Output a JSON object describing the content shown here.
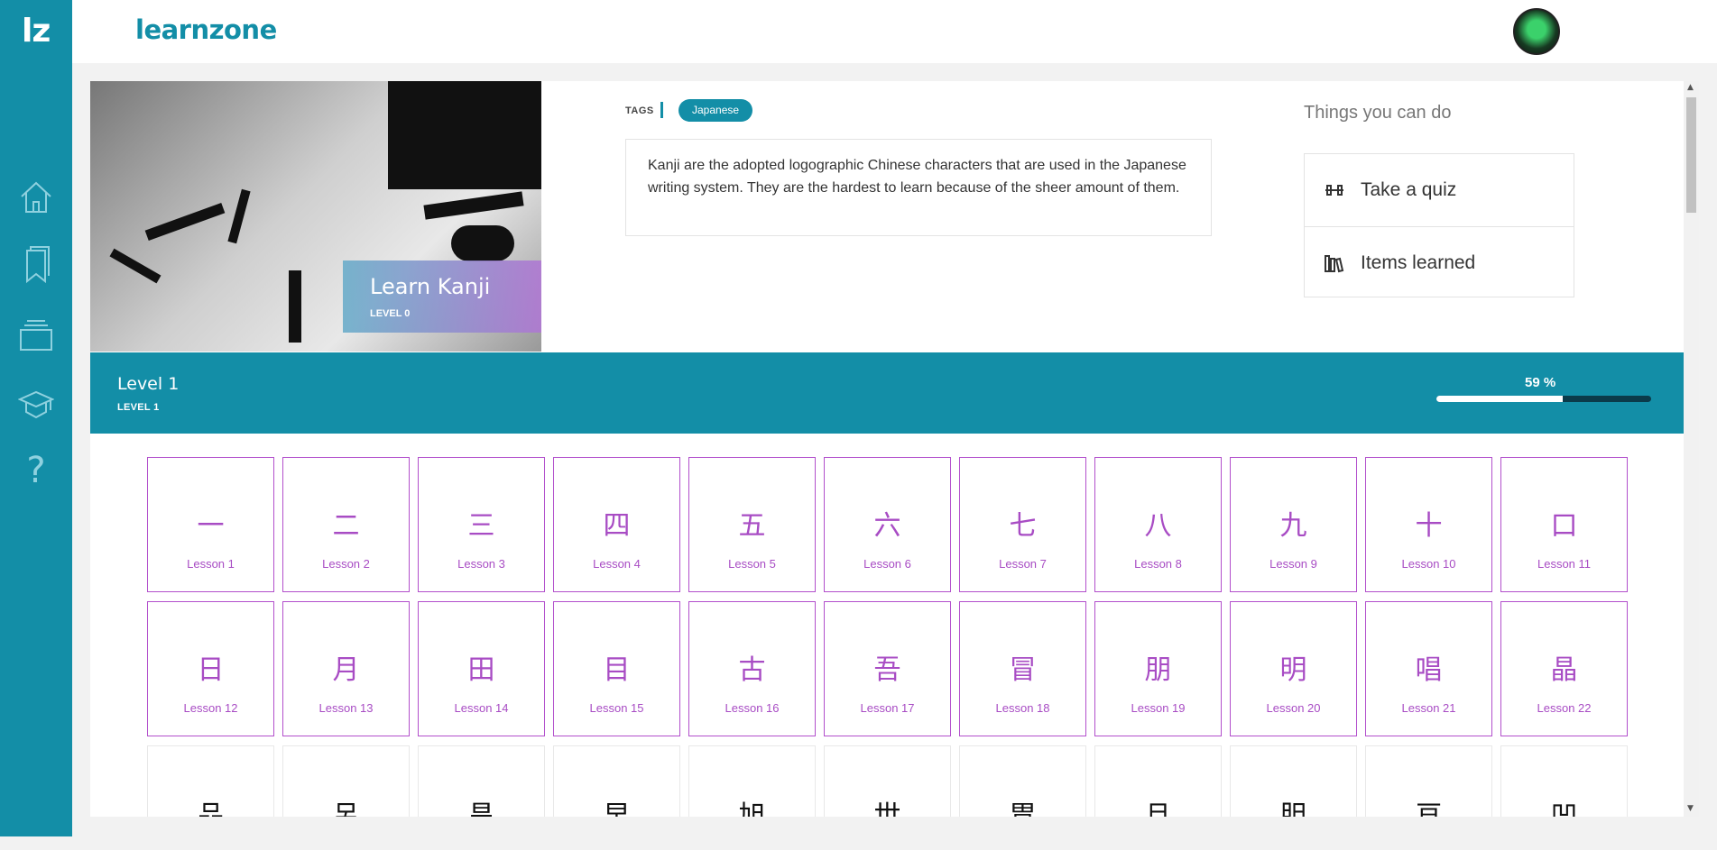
{
  "sidebar": {
    "logo": "lz",
    "nav": [
      {
        "icon": "home-icon"
      },
      {
        "icon": "bookmarks-icon"
      },
      {
        "icon": "stack-icon"
      },
      {
        "icon": "graduation-cap-icon"
      },
      {
        "icon": "help-icon",
        "glyph": "?"
      }
    ]
  },
  "header": {
    "brand": "learnzone",
    "avatar": "user-avatar"
  },
  "course": {
    "title": "Learn Kanji",
    "level_label": "LEVEL 0",
    "tags_label": "TAGS",
    "tags": [
      "Japanese"
    ],
    "description": "Kanji are the adopted logographic Chinese characters that are used in the Japanese writing system. They are the hardest to learn because of the sheer amount of them."
  },
  "things": {
    "title": "Things you can do",
    "actions": [
      {
        "label": "Take a quiz",
        "icon": "dumbbell-icon"
      },
      {
        "label": "Items learned",
        "icon": "books-icon"
      }
    ]
  },
  "level": {
    "name": "Level 1",
    "sub": "LEVEL 1",
    "progress_text": "59 %",
    "progress": 0.59
  },
  "lessons": [
    {
      "kanji": "一",
      "label": "Lesson 1"
    },
    {
      "kanji": "二",
      "label": "Lesson 2"
    },
    {
      "kanji": "三",
      "label": "Lesson 3"
    },
    {
      "kanji": "四",
      "label": "Lesson 4"
    },
    {
      "kanji": "五",
      "label": "Lesson 5"
    },
    {
      "kanji": "六",
      "label": "Lesson 6"
    },
    {
      "kanji": "七",
      "label": "Lesson 7"
    },
    {
      "kanji": "八",
      "label": "Lesson 8"
    },
    {
      "kanji": "九",
      "label": "Lesson 9"
    },
    {
      "kanji": "十",
      "label": "Lesson 10"
    },
    {
      "kanji": "口",
      "label": "Lesson 11"
    },
    {
      "kanji": "日",
      "label": "Lesson 12"
    },
    {
      "kanji": "月",
      "label": "Lesson 13"
    },
    {
      "kanji": "田",
      "label": "Lesson 14"
    },
    {
      "kanji": "目",
      "label": "Lesson 15"
    },
    {
      "kanji": "古",
      "label": "Lesson 16"
    },
    {
      "kanji": "吾",
      "label": "Lesson 17"
    },
    {
      "kanji": "冒",
      "label": "Lesson 18"
    },
    {
      "kanji": "朋",
      "label": "Lesson 19"
    },
    {
      "kanji": "明",
      "label": "Lesson 20"
    },
    {
      "kanji": "唱",
      "label": "Lesson 21"
    },
    {
      "kanji": "晶",
      "label": "Lesson 22"
    },
    {
      "kanji": "品",
      "label": ""
    },
    {
      "kanji": "呂",
      "label": ""
    },
    {
      "kanji": "昌",
      "label": ""
    },
    {
      "kanji": "早",
      "label": ""
    },
    {
      "kanji": "旭",
      "label": ""
    },
    {
      "kanji": "世",
      "label": ""
    },
    {
      "kanji": "胃",
      "label": ""
    },
    {
      "kanji": "旦",
      "label": ""
    },
    {
      "kanji": "胆",
      "label": ""
    },
    {
      "kanji": "亘",
      "label": ""
    },
    {
      "kanji": "凹",
      "label": ""
    }
  ],
  "colors": {
    "brand": "#138ea7",
    "lesson": "#a84cc4"
  }
}
